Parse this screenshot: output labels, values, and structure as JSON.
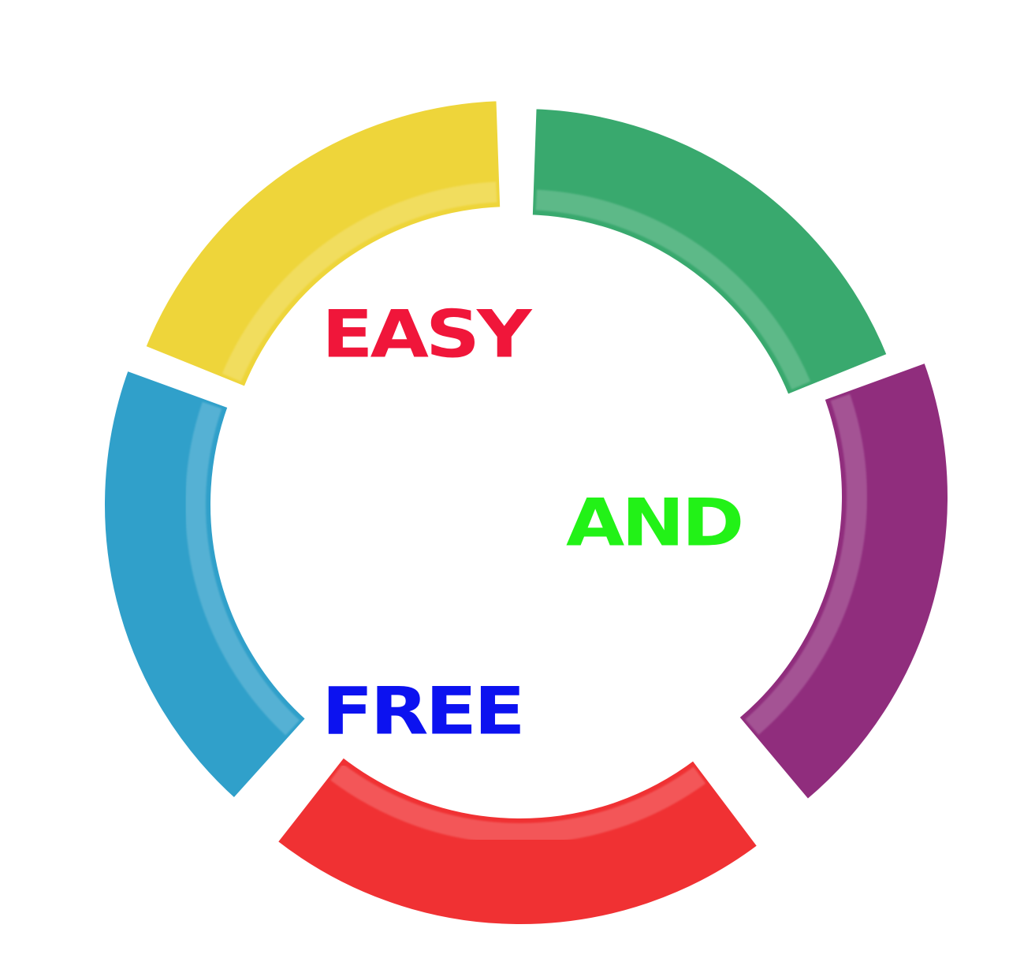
{
  "words": [
    {
      "text": "EASY",
      "color": "#f0163a"
    },
    {
      "text": "AND",
      "color": "#22f217"
    },
    {
      "text": "FREE",
      "color": "#0c12f0"
    }
  ],
  "segments": [
    {
      "color": "#23a05e"
    },
    {
      "color": "#84166f"
    },
    {
      "color": "#ee1b1d"
    },
    {
      "color": "#1a96c4"
    },
    {
      "color": "#ecd025"
    }
  ]
}
